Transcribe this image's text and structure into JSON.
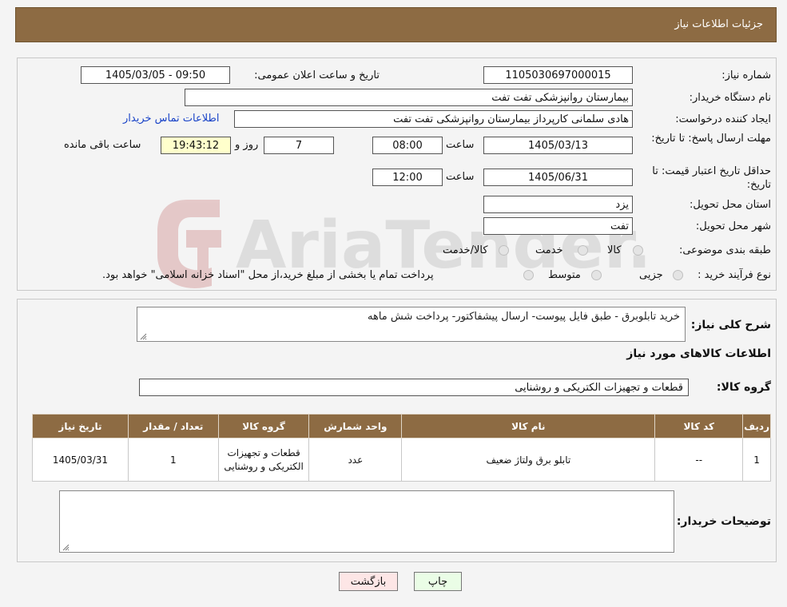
{
  "header": {
    "title": "جزئیات اطلاعات نیاز"
  },
  "form": {
    "need_number": {
      "label": "شماره نیاز:",
      "value": "1105030697000015"
    },
    "announce_datetime": {
      "label": "تاریخ و ساعت اعلان عمومی:",
      "value": "1405/03/05 - 09:50"
    },
    "buyer_org": {
      "label": "نام دستگاه خریدار:",
      "value": "بیمارستان روانپزشکی تفت تفت"
    },
    "requester": {
      "label": "ایجاد کننده درخواست:",
      "value": "هادی سلمانی کارپرداز بیمارستان روانپزشکی تفت تفت"
    },
    "contact_link": "اطلاعات تماس خریدار",
    "reply_deadline": {
      "label": "مهلت ارسال پاسخ: تا تاریخ:",
      "date": "1405/03/13",
      "time_label": "ساعت",
      "time": "08:00",
      "days": "7",
      "days_label": "روز و",
      "remaining_time": "19:43:12",
      "remaining_label": "ساعت باقی مانده"
    },
    "price_validity": {
      "label": "حداقل تاریخ اعتبار قیمت: تا تاریخ:",
      "date": "1405/06/31",
      "time_label": "ساعت",
      "time": "12:00"
    },
    "province": {
      "label": "استان محل تحویل:",
      "value": "یزد"
    },
    "city": {
      "label": "شهر محل تحویل:",
      "value": "تفت"
    },
    "category": {
      "label": "طبقه بندی موضوعی:",
      "options": [
        "کالا",
        "خدمت",
        "کالا/خدمت"
      ]
    },
    "purchase_type": {
      "label": "نوع فرآیند خرید :",
      "options": [
        "جزیی",
        "متوسط"
      ],
      "note": "پرداخت تمام یا بخشی از مبلغ خرید،از محل \"اسناد خزانه اسلامی\" خواهد بود."
    }
  },
  "description": {
    "label": "شرح کلی نیاز:",
    "value": "خرید تابلوبرق - طبق فایل پیوست- ارسال پیشفاکتور- پرداخت شش ماهه"
  },
  "goods": {
    "section_title": "اطلاعات کالاهای مورد نیاز",
    "group_label": "گروه کالا:",
    "group_value": "قطعات و تجهیزات الکتریکی و روشنایی",
    "columns": [
      "ردیف",
      "کد کالا",
      "نام کالا",
      "واحد شمارش",
      "گروه کالا",
      "تعداد / مقدار",
      "تاریخ نیاز"
    ],
    "rows": [
      {
        "row": "1",
        "code": "--",
        "name": "تابلو برق ولتاژ ضعیف",
        "unit": "عدد",
        "group": "قطعات و تجهیزات الکتریکی و روشنایی",
        "qty": "1",
        "date": "1405/03/31"
      }
    ]
  },
  "buyer_notes": {
    "label": "توضیحات خریدار:",
    "value": ""
  },
  "buttons": {
    "print": "چاپ",
    "back": "بازگشت"
  },
  "watermark_text": "AriaTender.neT",
  "colors": {
    "header": "#8d6b43",
    "link": "#1a44c8",
    "remaining_bg": "#ffffcc"
  }
}
